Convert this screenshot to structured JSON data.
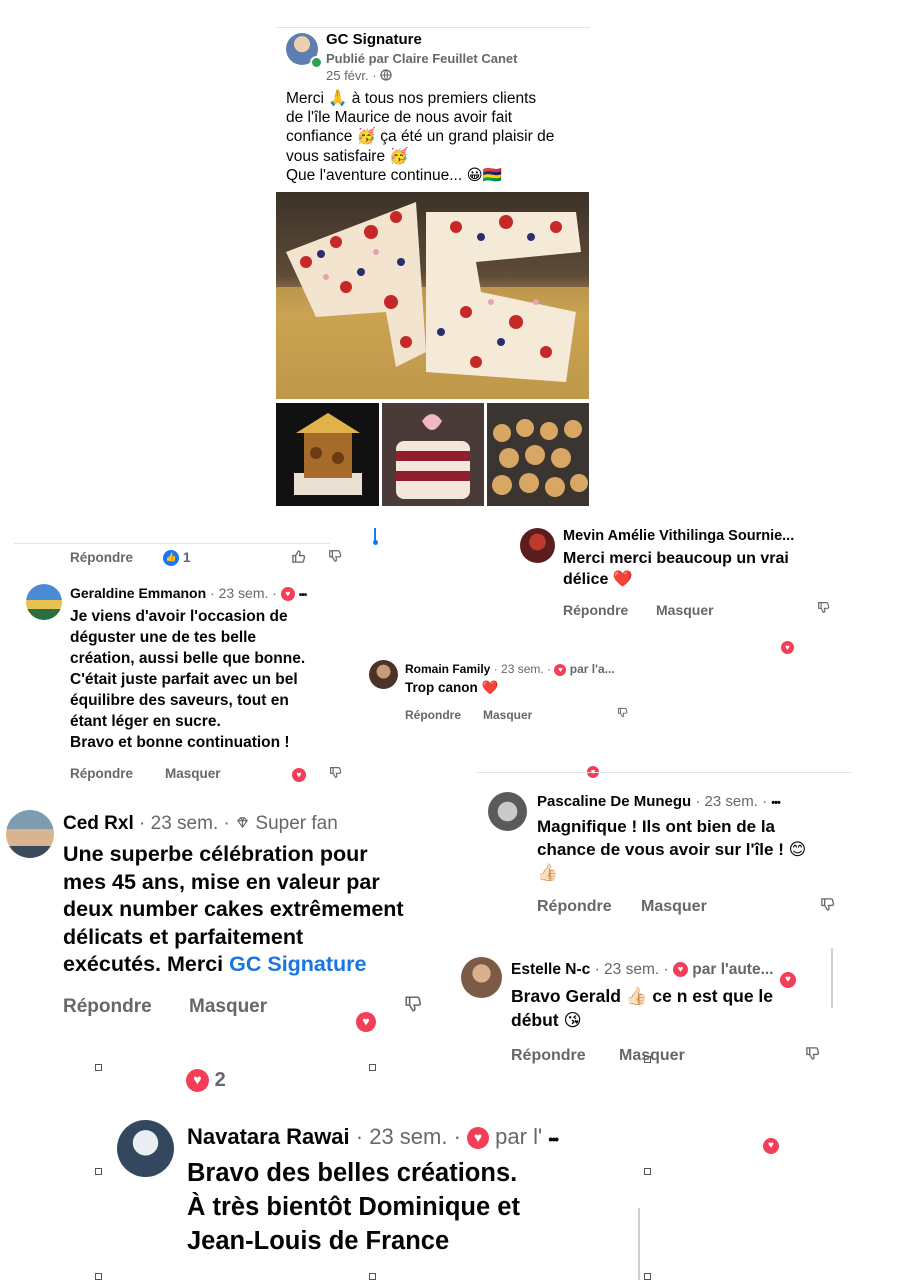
{
  "post": {
    "page_name": "GC Signature",
    "published_by": "Publié par Claire Feuillet Canet",
    "date": "25 févr.",
    "globe_sep": "·",
    "text_lines": [
      "Merci 🙏 à tous nos premiers clients",
      "de l'île Maurice de nous avoir fait",
      "confiance 🥳 ça été un grand plaisir de",
      "vous satisfaire 🥳",
      "Que l'aventure continue... 😀🇲🇺"
    ]
  },
  "top_actions": {
    "reply": "Répondre",
    "like_count": "1"
  },
  "comments": {
    "geraldine": {
      "name": "Geraldine Emmanon",
      "meta": "· 23 sem. ·",
      "more": "•••",
      "text_lines": [
        "Je viens d'avoir l'occasion de",
        "déguster une de tes belle",
        "création, aussi belle que bonne.",
        "C'était juste parfait avec un bel",
        "équilibre des saveurs, tout en",
        "étant léger en sucre.",
        "Bravo et bonne continuation !"
      ],
      "reply": "Répondre",
      "hide": "Masquer"
    },
    "ced": {
      "name": "Ced Rxl",
      "meta": "· 23 sem. ·",
      "badge": "Super fan",
      "text_lines": [
        "Une superbe célébration pour",
        "mes 45 ans, mise en valeur par",
        "deux number cakes extrêmement",
        "délicats et parfaitement"
      ],
      "last_line": "exécutés. Merci ",
      "mention": "GC Signature",
      "reply": "Répondre",
      "hide": "Masquer",
      "reaction_count": "2"
    },
    "navatara": {
      "name": "Navatara Rawai",
      "meta": "· 23 sem. ·",
      "author_tag": "par l'",
      "more": "•••",
      "text_lines": [
        "Bravo des belles créations.",
        "À très bientôt Dominique et",
        "Jean-Louis de France"
      ]
    },
    "mevin": {
      "name": "Mevin Amélie Vithilinga Sournie...",
      "text_lines": [
        "Merci merci beaucoup un vrai",
        "délice ❤️"
      ],
      "reply": "Répondre",
      "hide": "Masquer"
    },
    "romain": {
      "name": "Romain Family",
      "meta": "· 23 sem. ·",
      "author_tag": "par l'a...",
      "text": "Trop canon ❤️",
      "reply": "Répondre",
      "hide": "Masquer"
    },
    "pascaline": {
      "name": "Pascaline De Munegu",
      "meta": "· 23 sem. ·",
      "more": "•••",
      "text_lines": [
        "Magnifique ! Ils ont bien de la",
        "chance de vous avoir sur l'île ! 😊",
        "👍🏻"
      ],
      "reply": "Répondre",
      "hide": "Masquer"
    },
    "estelle": {
      "name": "Estelle N-c",
      "meta": "· 23 sem. ·",
      "author_tag": "par l'aute...",
      "text_lines": [
        "Bravo Gerald 👍🏻 ce n est que le",
        "début 😘"
      ],
      "reply": "Répondre",
      "hide": "Masquer"
    }
  },
  "icons": {
    "heart": "heart-reaction-icon",
    "like": "like-reaction-icon",
    "thumbs_up": "thumbs-up-outline-icon",
    "thumbs_down": "thumbs-down-outline-icon",
    "globe": "globe-icon",
    "diamond": "diamond-icon"
  },
  "colors": {
    "heart": "#f33e58",
    "like": "#1877f2",
    "mention": "#1b74e4",
    "grey_text": "#65676b"
  }
}
